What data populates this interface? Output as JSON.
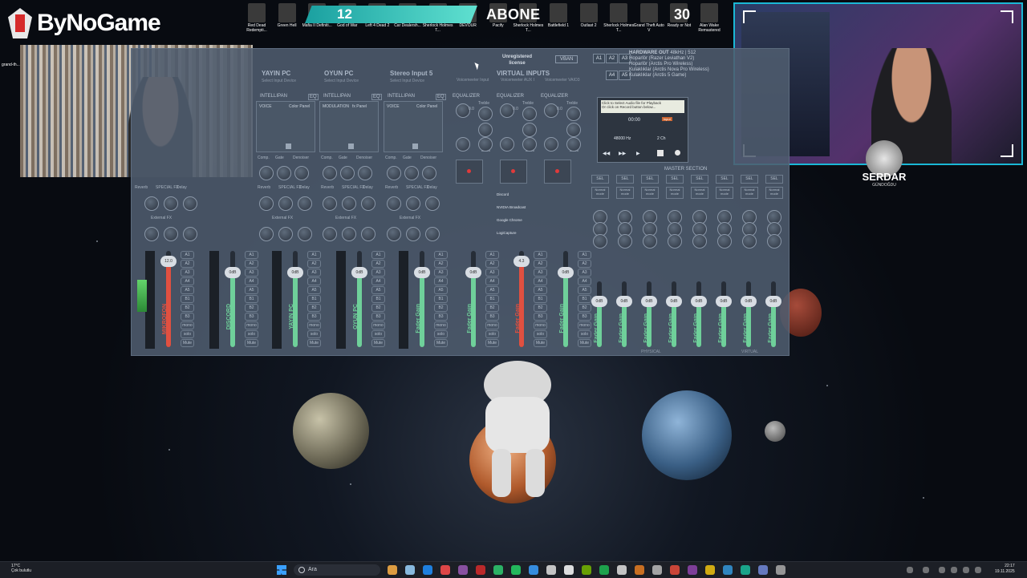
{
  "overlay": {
    "brand": "ByNoGame",
    "banner_number": "12",
    "abone_label": "ABONE",
    "counter": "30",
    "game_icons": [
      "Red Dead Redempti...",
      "Green Hell",
      "Mafia II Definiti...",
      "God of War",
      "Left 4 Dead 2",
      "Car Dealersh...",
      "Sherlock Holmes T...",
      "DEVOUR",
      "Pacify",
      "Sherlock Holmes T...",
      "Battlefield 1",
      "Outlast 2",
      "Sherlock Holmes T...",
      "Grand Theft Auto V",
      "Ready or Not",
      "Alan Wake Remastered"
    ],
    "badge_name": "SERDAR",
    "badge_sub": "GÜNDOĞDU",
    "left_desktop_label": "grand-th..."
  },
  "vm": {
    "strips": [
      {
        "title": "YAYIN PC",
        "sub": "Select Input Device"
      },
      {
        "title": "OYUN PC",
        "sub": "Select Input Device"
      },
      {
        "title": "Stereo Input 5",
        "sub": "Select Input Device"
      }
    ],
    "virtual_inputs_title": "VIRTUAL INPUTS",
    "virtual_subs": [
      "Voicemeeter Input",
      "Voicemeeter AUX I",
      "Voicemeeter VAIO3"
    ],
    "unregistered": "Unregistered",
    "license": "license",
    "vban": "VBAN",
    "hardware_out_title": "HARDWARE OUT",
    "hardware_out_rate": "48kHz | 512",
    "hardware_devices": [
      "Hoparlör (Razer Leviathan V2)",
      "Hoparlör (Arctis Pro Wireless)",
      "Kulaklıklar (Arctis Nova Pro Wireless)",
      "Kulaklıklar (Arctis 5 Game)"
    ],
    "out_buttons": [
      "A1",
      "A2",
      "A3",
      "A4",
      "A5"
    ],
    "pad_labels": [
      "VOICE",
      "MODULATION",
      "VOICE"
    ],
    "pad_panel_labels": [
      "Color Panel",
      "fx Panel",
      "Color Panel"
    ],
    "intellipan": "INTELLIPAN",
    "eq_short": "EQ",
    "equalizer": "EQUALIZER",
    "eq_labels": [
      "Treble",
      "Bass"
    ],
    "eq_value": "0.0",
    "knob_labels": [
      "Comp.",
      "Gate",
      "Denoiser"
    ],
    "fx_labels": [
      "Reverb",
      "SPECIAL FX",
      "Delay"
    ],
    "external_fx": "External FX",
    "fader_gain": "Fader Gain",
    "channels": [
      {
        "label": "MIKROFON",
        "gain": "12.0",
        "color": "#e05040"
      },
      {
        "label": "DISCORD",
        "gain": "0dB",
        "color": "#6fd09a"
      },
      {
        "label": "YAYIN PC",
        "gain": "0dB",
        "color": "#6fd09a"
      },
      {
        "label": "OYUN PC",
        "gain": "0dB",
        "color": "#6fd09a"
      },
      {
        "label": "Fader Gain",
        "gain": "0dB",
        "color": "#6fd09a"
      },
      {
        "label": "Fader Gain",
        "gain": "0dB",
        "color": "#6fd09a"
      },
      {
        "label": "Fader Gain",
        "gain": "4.3",
        "color": "#e05040"
      },
      {
        "label": "Fader Gain",
        "gain": "0dB",
        "color": "#6fd09a"
      }
    ],
    "bus_buttons": [
      "A1",
      "A2",
      "A3",
      "A4",
      "A5",
      "B1",
      "B2",
      "B3",
      "mono",
      "solo",
      "Mute"
    ],
    "deck": {
      "text": "Click to Select Audio file for Playback",
      "text2": "Or click on Record button below...",
      "time": "00:00",
      "freq": "48000 Hz",
      "ch": "2 Ch",
      "input_label": "input"
    },
    "master_section": "MASTER SECTION",
    "master_sel": "SEL",
    "master_normal": "Normal mode",
    "master_gain": "0dB",
    "physical": "PHYSICAL",
    "virtual": "VIRTUAL",
    "apps": [
      "Discord",
      "NVIDIA Broadcast",
      "Google Chrome",
      "LogiCapture"
    ]
  },
  "taskbar": {
    "weather_temp": "17°C",
    "weather_text": "Çok bulutlu",
    "search": "Ara",
    "time": "22:17",
    "date": "19.11.2025"
  }
}
